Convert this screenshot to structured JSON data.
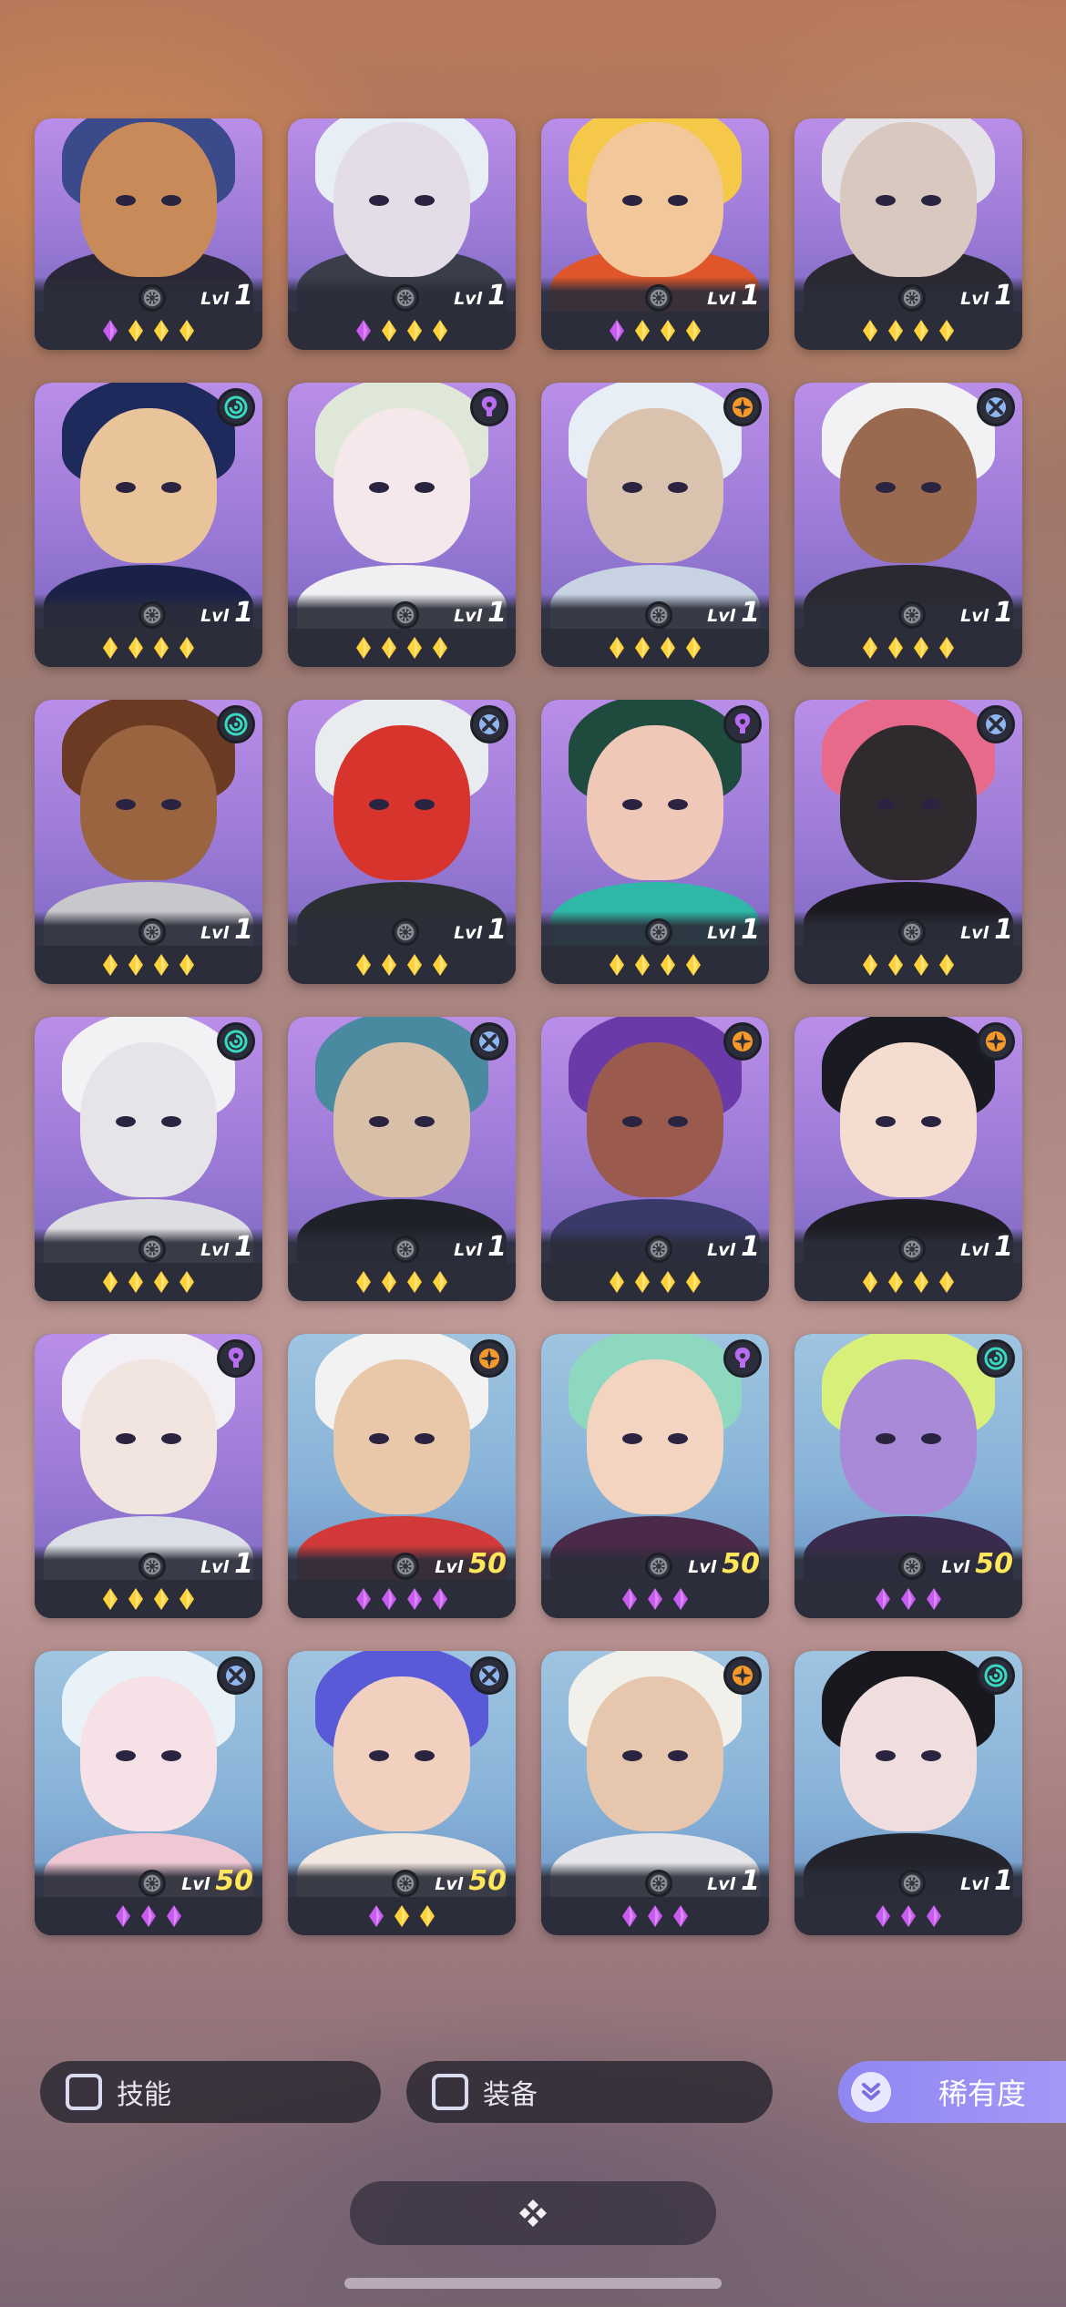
{
  "colors": {
    "purple_gem": "#c85cf0",
    "gold_gem": "#ffd23a",
    "class_teal": "#38d9c0",
    "class_purple": "#b86cf0",
    "class_orange": "#f59a2a",
    "class_blue": "#8fb6f0",
    "accent": "#9a90f5"
  },
  "heroes": [
    {
      "bg": "purple",
      "skin": "#c98a5a",
      "hair": "#3a4a8a",
      "body": "#2a2838",
      "class": "none",
      "lvl_label": "Lvl",
      "level": "1",
      "gold_level": false,
      "gems": [
        "purple",
        "gold",
        "gold",
        "gold"
      ],
      "cut": true
    },
    {
      "bg": "purple",
      "skin": "#e4dde8",
      "hair": "#e8eef6",
      "body": "#3a3e4a",
      "class": "none",
      "lvl_label": "Lvl",
      "level": "1",
      "gold_level": false,
      "gems": [
        "purple",
        "gold",
        "gold",
        "gold"
      ],
      "cut": true
    },
    {
      "bg": "purple",
      "skin": "#f2c79a",
      "hair": "#f5c84a",
      "body": "#e0562a",
      "class": "none",
      "lvl_label": "Lvl",
      "level": "1",
      "gold_level": false,
      "gems": [
        "purple",
        "gold",
        "gold",
        "gold"
      ],
      "cut": true
    },
    {
      "bg": "purple",
      "skin": "#d8c8c0",
      "hair": "#e6e3e8",
      "body": "#2a2830",
      "class": "none",
      "lvl_label": "Lvl",
      "level": "1",
      "gold_level": false,
      "gems": [
        "gold",
        "gold",
        "gold",
        "gold"
      ],
      "cut": true
    },
    {
      "bg": "purple",
      "skin": "#e9c39a",
      "hair": "#1e2a5c",
      "body": "#1a2148",
      "class": "teal",
      "lvl_label": "Lvl",
      "level": "1",
      "gold_level": false,
      "gems": [
        "gold",
        "gold",
        "gold",
        "gold"
      ],
      "cut": false
    },
    {
      "bg": "purple",
      "skin": "#f4e8ea",
      "hair": "#dfe8d8",
      "body": "#f0f0f2",
      "class": "purple",
      "lvl_label": "Lvl",
      "level": "1",
      "gold_level": false,
      "gems": [
        "gold",
        "gold",
        "gold",
        "gold"
      ],
      "cut": false
    },
    {
      "bg": "purple",
      "skin": "#d9c2ae",
      "hair": "#e8eef5",
      "body": "#c7d2e2",
      "class": "orange",
      "lvl_label": "Lvl",
      "level": "1",
      "gold_level": false,
      "gems": [
        "gold",
        "gold",
        "gold",
        "gold"
      ],
      "cut": false
    },
    {
      "bg": "purple",
      "skin": "#9a6a50",
      "hair": "#f2f2f4",
      "body": "#2a2830",
      "class": "blue",
      "lvl_label": "Lvl",
      "level": "1",
      "gold_level": false,
      "gems": [
        "gold",
        "gold",
        "gold",
        "gold"
      ],
      "cut": false
    },
    {
      "bg": "purple",
      "skin": "#9a6440",
      "hair": "#6a3a22",
      "body": "#c8c8cc",
      "class": "teal",
      "lvl_label": "Lvl",
      "level": "1",
      "gold_level": false,
      "gems": [
        "gold",
        "gold",
        "gold",
        "gold"
      ],
      "cut": false
    },
    {
      "bg": "purple",
      "skin": "#d8342e",
      "hair": "#e8ecef",
      "body": "#2a3032",
      "class": "blue",
      "lvl_label": "Lvl",
      "level": "1",
      "gold_level": false,
      "gems": [
        "gold",
        "gold",
        "gold",
        "gold"
      ],
      "cut": false
    },
    {
      "bg": "purple",
      "skin": "#f0c8b8",
      "hair": "#1f4a3e",
      "body": "#2fb8a8",
      "class": "purple",
      "lvl_label": "Lvl",
      "level": "1",
      "gold_level": false,
      "gems": [
        "gold",
        "gold",
        "gold",
        "gold"
      ],
      "cut": false
    },
    {
      "bg": "purple",
      "skin": "#2e2a2e",
      "hair": "#e86a8a",
      "body": "#1c1a20",
      "class": "blue",
      "lvl_label": "Lvl",
      "level": "1",
      "gold_level": false,
      "gems": [
        "gold",
        "gold",
        "gold",
        "gold"
      ],
      "cut": false
    },
    {
      "bg": "purple",
      "skin": "#e6e4e8",
      "hair": "#f2f2f4",
      "body": "#dedde2",
      "class": "teal",
      "lvl_label": "Lvl",
      "level": "1",
      "gold_level": false,
      "gems": [
        "gold",
        "gold",
        "gold",
        "gold"
      ],
      "cut": false
    },
    {
      "bg": "purple",
      "skin": "#d8c0a8",
      "hair": "#4a8aa0",
      "body": "#1e2228",
      "class": "blue",
      "lvl_label": "Lvl",
      "level": "1",
      "gold_level": false,
      "gems": [
        "gold",
        "gold",
        "gold",
        "gold"
      ],
      "cut": false
    },
    {
      "bg": "purple",
      "skin": "#9a5a4e",
      "hair": "#6a3aa8",
      "body": "#3a3a6a",
      "class": "orange",
      "lvl_label": "Lvl",
      "level": "1",
      "gold_level": false,
      "gems": [
        "gold",
        "gold",
        "gold",
        "gold"
      ],
      "cut": false
    },
    {
      "bg": "purple",
      "skin": "#f4dcd0",
      "hair": "#1a1a22",
      "body": "#1c1c22",
      "class": "orange",
      "lvl_label": "Lvl",
      "level": "1",
      "gold_level": false,
      "gems": [
        "gold",
        "gold",
        "gold",
        "gold"
      ],
      "cut": false
    },
    {
      "bg": "purple",
      "skin": "#f2e4de",
      "hair": "#f2f0f4",
      "body": "#dcdfe6",
      "class": "purple",
      "lvl_label": "Lvl",
      "level": "1",
      "gold_level": false,
      "gems": [
        "gold",
        "gold",
        "gold",
        "gold"
      ],
      "cut": false
    },
    {
      "bg": "blue",
      "skin": "#e8c8a8",
      "hair": "#f2f2f2",
      "body": "#d23a3a",
      "class": "orange",
      "lvl_label": "Lvl",
      "level": "50",
      "gold_level": true,
      "gems": [
        "purple",
        "purple",
        "purple",
        "purple"
      ],
      "cut": false
    },
    {
      "bg": "blue",
      "skin": "#f2d4c0",
      "hair": "#8ed8c0",
      "body": "#4a2a48",
      "class": "purple",
      "lvl_label": "Lvl",
      "level": "50",
      "gold_level": true,
      "gems": [
        "purple",
        "purple",
        "purple"
      ],
      "cut": false
    },
    {
      "bg": "blue",
      "skin": "#a88ad8",
      "hair": "#d8f07a",
      "body": "#3a2a4e",
      "class": "teal",
      "lvl_label": "Lvl",
      "level": "50",
      "gold_level": true,
      "gems": [
        "purple",
        "purple",
        "purple"
      ],
      "cut": false
    },
    {
      "bg": "blue",
      "skin": "#f6e2e6",
      "hair": "#e8f2f8",
      "body": "#f0c8d4",
      "class": "blue",
      "lvl_label": "Lvl",
      "level": "50",
      "gold_level": true,
      "gems": [
        "purple",
        "purple",
        "purple"
      ],
      "cut": false
    },
    {
      "bg": "blue",
      "skin": "#f2d0c0",
      "hair": "#5a5ad8",
      "body": "#f2e8e0",
      "class": "blue",
      "lvl_label": "Lvl",
      "level": "50",
      "gold_level": true,
      "gems": [
        "purple",
        "gold",
        "gold"
      ],
      "cut": false
    },
    {
      "bg": "blue",
      "skin": "#e6c6ac",
      "hair": "#f2f0ea",
      "body": "#e6e6ea",
      "class": "orange",
      "lvl_label": "Lvl",
      "level": "1",
      "gold_level": false,
      "gems": [
        "purple",
        "purple",
        "purple"
      ],
      "cut": false
    },
    {
      "bg": "blue",
      "skin": "#f0dede",
      "hair": "#18181e",
      "body": "#22222a",
      "class": "teal",
      "lvl_label": "Lvl",
      "level": "1",
      "gold_level": false,
      "gems": [
        "purple",
        "purple",
        "purple"
      ],
      "cut": false
    }
  ],
  "filters": {
    "skills_label": "技能",
    "equipment_label": "装备",
    "rarity_label": "稀有度",
    "rarity_icon": "double-chevron-down-icon"
  },
  "bottom_pill_icon": "diamond-cluster-icon"
}
